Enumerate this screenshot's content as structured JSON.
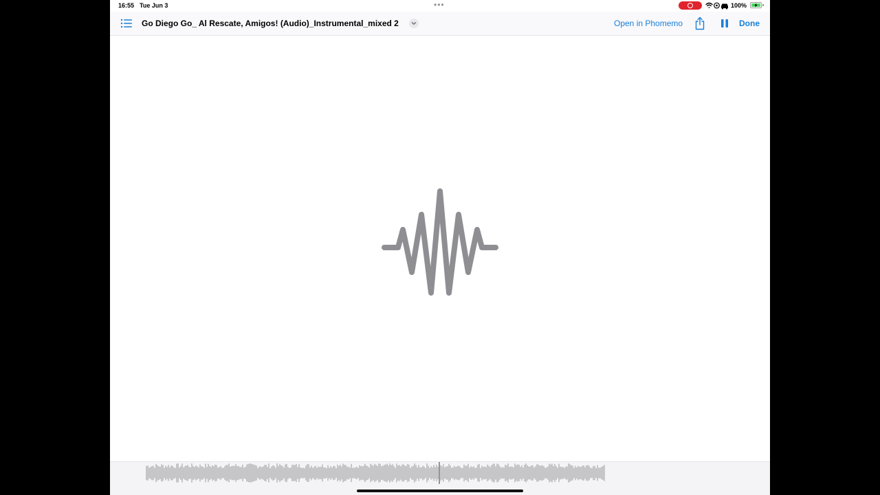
{
  "status_bar": {
    "time": "16:55",
    "date": "Tue Jun 3",
    "battery": "100%",
    "battery_level": 1.0,
    "icons": [
      "wifi-icon",
      "location-icon",
      "car-icon"
    ]
  },
  "nav": {
    "title": "Go Diego Go_ Al Rescate, Amigos! (Audio)_Instrumental_mixed 2",
    "open_in": "Open in Phomemo",
    "done": "Done"
  },
  "colors": {
    "accent": "#1a7fd6",
    "waveform": "#8e8e93",
    "recording": "#e0242d"
  }
}
